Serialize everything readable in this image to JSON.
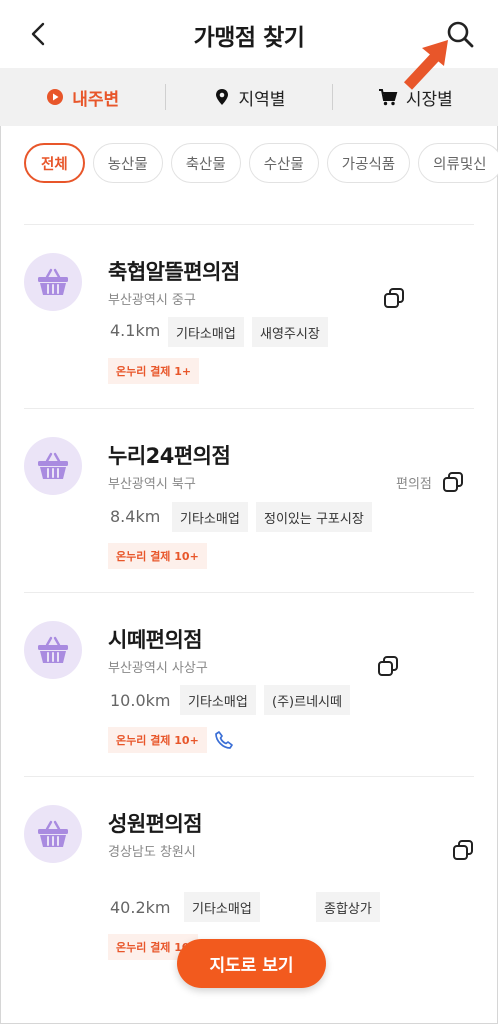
{
  "header": {
    "title": "가맹점 찾기"
  },
  "tabs": [
    {
      "label": "내주변",
      "icon": "location-play-icon",
      "active": true
    },
    {
      "label": "지역별",
      "icon": "map-pin-icon",
      "active": false
    },
    {
      "label": "시장별",
      "icon": "cart-icon",
      "active": false
    }
  ],
  "chips": [
    "전체",
    "농산물",
    "축산물",
    "수산물",
    "가공식품",
    "의류및신"
  ],
  "stores": [
    {
      "name": "축협알뜰편의점",
      "address": "부산광역시 중구",
      "category": "",
      "distance": "4.1km",
      "tags": [
        "기타소매업",
        "새영주시장"
      ],
      "badge": "온누리 결제 1+",
      "phone": false
    },
    {
      "name": "누리24편의점",
      "address": "부산광역시 북구",
      "category": "편의점",
      "distance": "8.4km",
      "tags": [
        "기타소매업",
        "정이있는 구포시장"
      ],
      "badge": "온누리 결제 10+",
      "phone": false
    },
    {
      "name": "시떼편의점",
      "address": "부산광역시 사상구",
      "category": "",
      "distance": "10.0km",
      "tags": [
        "기타소매업",
        "(주)르네시떼"
      ],
      "badge": "온누리 결제 10+",
      "phone": true
    },
    {
      "name": "성원편의점",
      "address": "경상남도 창원시",
      "category": "",
      "distance": "40.2km",
      "tags": [
        "기타소매업",
        "종합상가"
      ],
      "badge": "온누리 결제 10",
      "phone": false
    }
  ],
  "map_button": "지도로 보기",
  "colors": {
    "accent": "#e8562a",
    "avatar_bg": "#ebe4f7",
    "basket": "#a98be0"
  }
}
